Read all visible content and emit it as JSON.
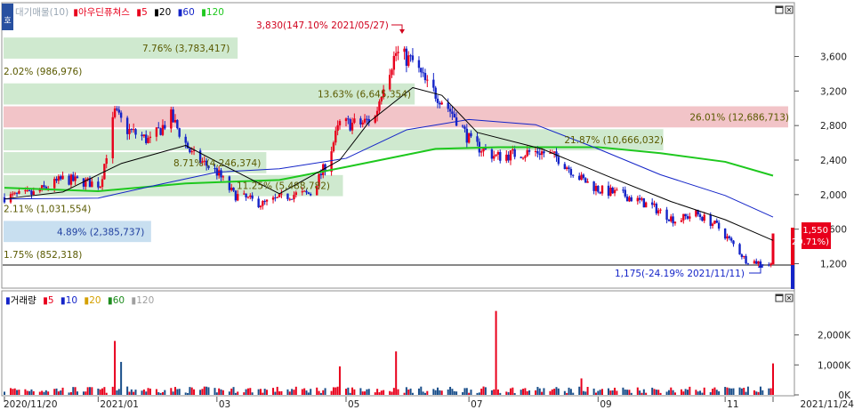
{
  "price_panel": {
    "legend": {
      "prefix": "대기매물(10)",
      "stock_name": "아우딘퓨쳐스",
      "ma_items": [
        {
          "label": "5",
          "color": "#e8001c"
        },
        {
          "label": "20",
          "color": "#000000"
        },
        {
          "label": "60",
          "color": "#1424c8"
        },
        {
          "label": "120",
          "color": "#1ec81e"
        }
      ]
    },
    "y_axis_ticks": [
      "3,600",
      "3,200",
      "2,800",
      "2,400",
      "2,000",
      "1,600",
      "1,200"
    ],
    "y_axis_values": [
      3600,
      3200,
      2800,
      2400,
      2000,
      1600,
      1200
    ],
    "last_price": {
      "value": "1,550",
      "change": "( 29.71%)"
    },
    "high_annotation": "3,830(147.10% 2021/05/27)",
    "low_annotation": "1,175(-24.19% 2021/11/11)",
    "volume_profile": [
      {
        "label": "7.76% (3,783,417)",
        "color": "green"
      },
      {
        "label": "2.02% (986,976)",
        "color": "none"
      },
      {
        "label": "13.63% (6,645,354)",
        "color": "green"
      },
      {
        "label": "26.01% (12,686,713)",
        "color": "red"
      },
      {
        "label": "21.87% (10,666,032)",
        "color": "green"
      },
      {
        "label": "8.71% (4,246,374)",
        "color": "green"
      },
      {
        "label": "11.25% (5,488,782)",
        "color": "green"
      },
      {
        "label": "2.11% (1,031,554)",
        "color": "none"
      },
      {
        "label": "4.89% (2,385,737)",
        "color": "blue"
      },
      {
        "label": "1.75% (852,318)",
        "color": "none"
      }
    ]
  },
  "volume_panel": {
    "legend": {
      "title": "거래량",
      "ma_items": [
        {
          "label": "5",
          "color": "#e8001c"
        },
        {
          "label": "10",
          "color": "#1424c8"
        },
        {
          "label": "20",
          "color": "#d4a000"
        },
        {
          "label": "60",
          "color": "#1e8c1e"
        },
        {
          "label": "120",
          "color": "#a0a0a0"
        }
      ]
    },
    "y_axis_ticks": [
      "2,000K",
      "1,000K",
      "0K"
    ]
  },
  "x_axis_labels": [
    "2020/11/20",
    "2021/01",
    "03",
    "05",
    "07",
    "09",
    "11",
    "2021/11/24"
  ],
  "colors": {
    "up": "#e8001c",
    "down": "#1424c8",
    "ma5": "#e8001c",
    "ma20": "#000000",
    "ma60": "#1424c8",
    "ma120": "#1ec81e",
    "band_green": "#cfe9cf",
    "band_red": "#f2c4c8",
    "band_blue": "#c8dff0"
  },
  "icons": {
    "panel_toggle": "panel-toggle-icon",
    "maximize": "maximize-icon",
    "close": "close-icon"
  },
  "chart_data": {
    "type": "candlestick",
    "period": {
      "start": "2020/11/20",
      "end": "2021/11/24"
    },
    "price_close_path": [
      [
        "2020/11/20",
        1970
      ],
      [
        "2020/12/04",
        2010
      ],
      [
        "2020/12/18",
        2180
      ],
      [
        "2021/01/05",
        2120
      ],
      [
        "2021/01/12",
        2950
      ],
      [
        "2021/01/18",
        2750
      ],
      [
        "2021/01/29",
        2620
      ],
      [
        "2021/02/08",
        2900
      ],
      [
        "2021/02/18",
        2460
      ],
      [
        "2021/03/02",
        2260
      ],
      [
        "2021/03/10",
        2000
      ],
      [
        "2021/03/24",
        1890
      ],
      [
        "2021/04/07",
        2000
      ],
      [
        "2021/04/16",
        2010
      ],
      [
        "2021/04/23",
        2330
      ],
      [
        "2021/04/30",
        2820
      ],
      [
        "2021/05/10",
        2820
      ],
      [
        "2021/05/17",
        2900
      ],
      [
        "2021/05/21",
        3300
      ],
      [
        "2021/05/27",
        3640
      ],
      [
        "2021/06/04",
        3540
      ],
      [
        "2021/06/11",
        3260
      ],
      [
        "2021/06/18",
        3100
      ],
      [
        "2021/06/25",
        2880
      ],
      [
        "2021/07/02",
        2600
      ],
      [
        "2021/07/14",
        2440
      ],
      [
        "2021/07/26",
        2480
      ],
      [
        "2021/08/04",
        2500
      ],
      [
        "2021/08/13",
        2420
      ],
      [
        "2021/08/24",
        2180
      ],
      [
        "2021/09/02",
        2050
      ],
      [
        "2021/09/13",
        2000
      ],
      [
        "2021/09/27",
        1860
      ],
      [
        "2021/10/08",
        1700
      ],
      [
        "2021/10/18",
        1780
      ],
      [
        "2021/10/28",
        1640
      ],
      [
        "2021/11/05",
        1420
      ],
      [
        "2021/11/11",
        1240
      ],
      [
        "2021/11/23",
        1190
      ],
      [
        "2021/11/24",
        1550
      ]
    ],
    "ma20_path": [
      [
        "2020/11/20",
        1950
      ],
      [
        "2020/12/18",
        2030
      ],
      [
        "2021/01/15",
        2360
      ],
      [
        "2021/02/15",
        2570
      ],
      [
        "2021/03/02",
        2380
      ],
      [
        "2021/04/01",
        2010
      ],
      [
        "2021/04/30",
        2400
      ],
      [
        "2021/05/14",
        2840
      ],
      [
        "2021/06/04",
        3240
      ],
      [
        "2021/06/18",
        3150
      ],
      [
        "2021/07/05",
        2720
      ],
      [
        "2021/08/05",
        2530
      ],
      [
        "2021/09/06",
        2210
      ],
      [
        "2021/10/06",
        1920
      ],
      [
        "2021/11/01",
        1710
      ],
      [
        "2021/11/24",
        1470
      ]
    ],
    "ma60_path": [
      [
        "2020/11/20",
        1950
      ],
      [
        "2021/01/04",
        1960
      ],
      [
        "2021/02/01",
        2110
      ],
      [
        "2021/03/02",
        2260
      ],
      [
        "2021/04/01",
        2300
      ],
      [
        "2021/05/03",
        2420
      ],
      [
        "2021/06/01",
        2750
      ],
      [
        "2021/07/01",
        2870
      ],
      [
        "2021/08/02",
        2810
      ],
      [
        "2021/09/01",
        2530
      ],
      [
        "2021/10/01",
        2230
      ],
      [
        "2021/11/01",
        1990
      ],
      [
        "2021/11/24",
        1740
      ]
    ],
    "ma120_path": [
      [
        "2020/11/20",
        2080
      ],
      [
        "2021/01/04",
        2040
      ],
      [
        "2021/02/15",
        2130
      ],
      [
        "2021/04/01",
        2170
      ],
      [
        "2021/05/03",
        2320
      ],
      [
        "2021/06/15",
        2530
      ],
      [
        "2021/07/15",
        2550
      ],
      [
        "2021/09/01",
        2550
      ],
      [
        "2021/10/01",
        2480
      ],
      [
        "2021/11/01",
        2380
      ],
      [
        "2021/11/24",
        2220
      ]
    ],
    "price_high": {
      "value": 3830,
      "date": "2021/05/27",
      "change_pct": 147.1
    },
    "price_low": {
      "value": 1175,
      "date": "2021/11/11",
      "change_pct": -24.19
    },
    "last_close": 1550,
    "last_change_pct": 29.71,
    "price_range_shown": [
      1100,
      3900
    ],
    "volume_ylim": [
      0,
      3000000
    ],
    "volume_spikes": [
      [
        "2021/01/12",
        1800000
      ],
      [
        "2021/01/15",
        1100000
      ],
      [
        "2021/05/27",
        1450000
      ],
      [
        "2021/04/30",
        950000
      ],
      [
        "2021/07/14",
        2800000
      ],
      [
        "2021/11/24",
        1050000
      ],
      [
        "2021/08/24",
        550000
      ]
    ],
    "volume_baseline": 200000
  }
}
